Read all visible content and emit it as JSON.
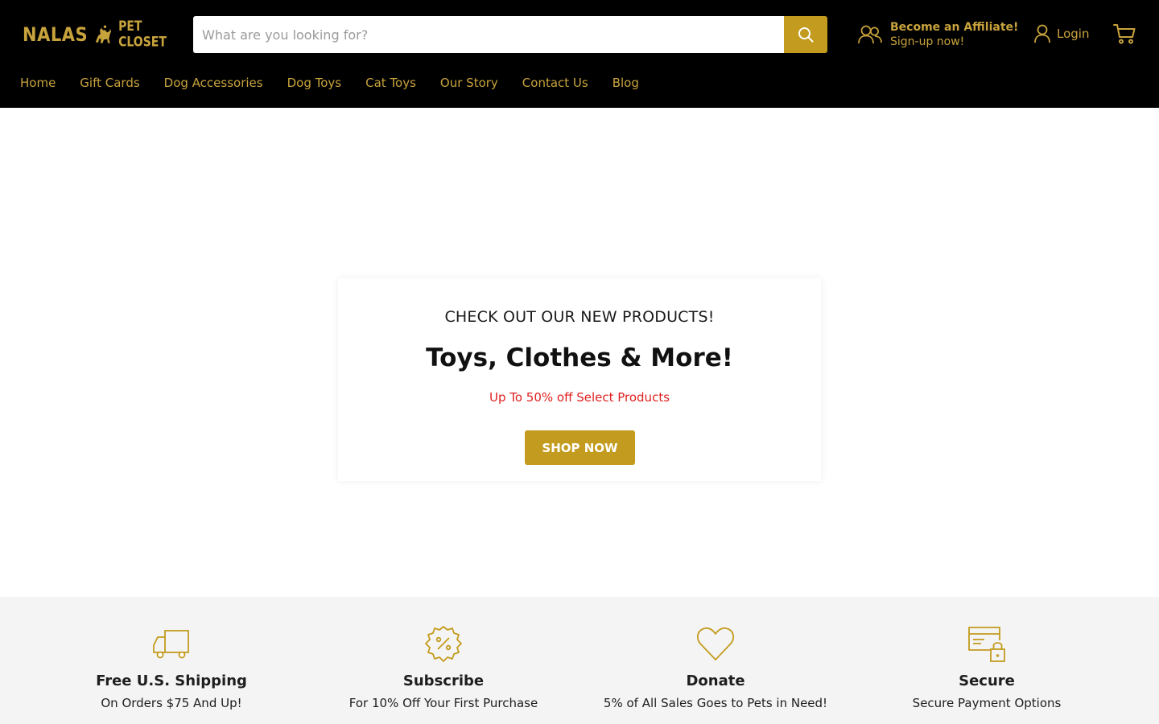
{
  "header": {
    "logo": {
      "main": "NALAS",
      "sub": "PET CLOSET"
    },
    "search": {
      "placeholder": "What are you looking for?",
      "value": ""
    },
    "affiliate": {
      "title": "Become an Affiliate!",
      "subtitle": "Sign-up now!"
    },
    "login_label": "Login"
  },
  "nav": {
    "items": [
      {
        "label": "Home"
      },
      {
        "label": "Gift Cards"
      },
      {
        "label": "Dog Accessories"
      },
      {
        "label": "Dog Toys"
      },
      {
        "label": "Cat Toys"
      },
      {
        "label": "Our Story"
      },
      {
        "label": "Contact Us"
      },
      {
        "label": "Blog"
      }
    ]
  },
  "promo": {
    "kicker": "CHECK OUT OUR NEW PRODUCTS!",
    "title": "Toys, Clothes & More!",
    "subtitle": "Up To 50% off Select Products",
    "button_label": "SHOP NOW"
  },
  "features": [
    {
      "icon": "truck-icon",
      "title": "Free U.S. Shipping",
      "text": "On Orders $75 And Up!"
    },
    {
      "icon": "percent-badge-icon",
      "title": "Subscribe",
      "text": "For 10% Off Your First Purchase"
    },
    {
      "icon": "heart-icon",
      "title": "Donate",
      "text": "5% of All Sales Goes to Pets in Need!"
    },
    {
      "icon": "secure-card-icon",
      "title": "Secure",
      "text": "Secure Payment Options"
    }
  ],
  "colors": {
    "header_bg": "#000000",
    "accent_gold": "#c39b1e",
    "nav_gold": "#c8a33c",
    "sale_red": "#e02020",
    "features_bg": "#f4f4f4"
  }
}
